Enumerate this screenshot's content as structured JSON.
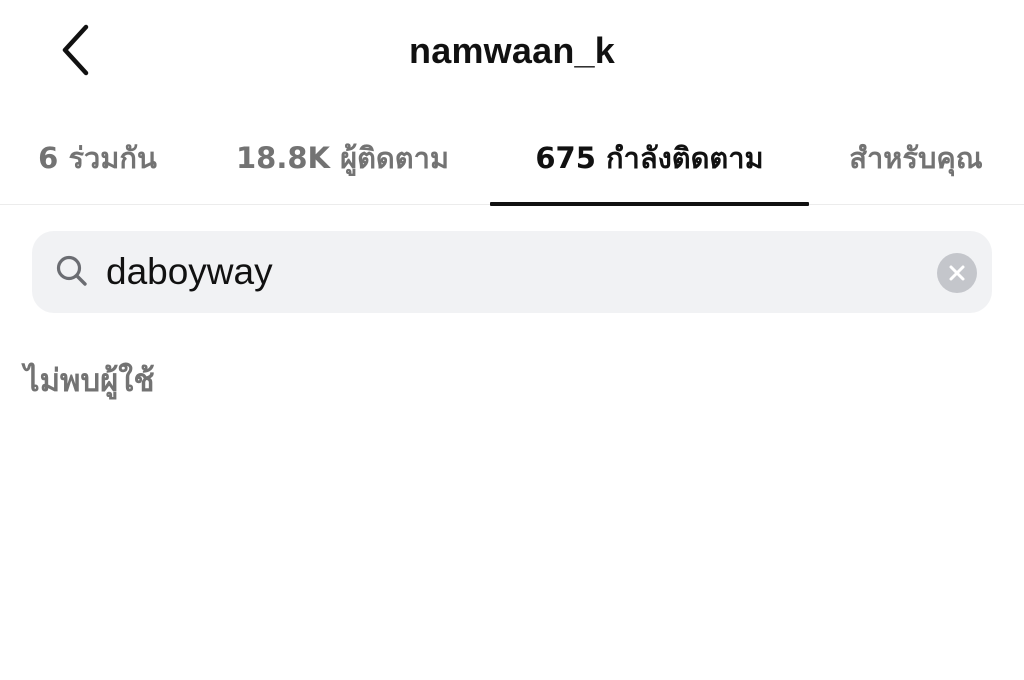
{
  "header": {
    "title": "namwaan_k",
    "back_icon": "chevron-left-icon"
  },
  "tabs": [
    {
      "label": "6 ร่วมกัน",
      "active": false
    },
    {
      "label": "18.8K ผู้ติดตาม",
      "active": false
    },
    {
      "label": "675 กำลังติดตาม",
      "active": true
    },
    {
      "label": "สำหรับคุณ",
      "active": false
    }
  ],
  "search": {
    "value": "daboyway",
    "icon": "search-icon",
    "clear_icon": "close-icon"
  },
  "results": {
    "empty_message": "ไม่พบผู้ใช้"
  },
  "colors": {
    "text_primary": "#111111",
    "text_secondary": "#737373",
    "search_bg": "#f1f2f4",
    "tab_indicator": "#111111"
  }
}
